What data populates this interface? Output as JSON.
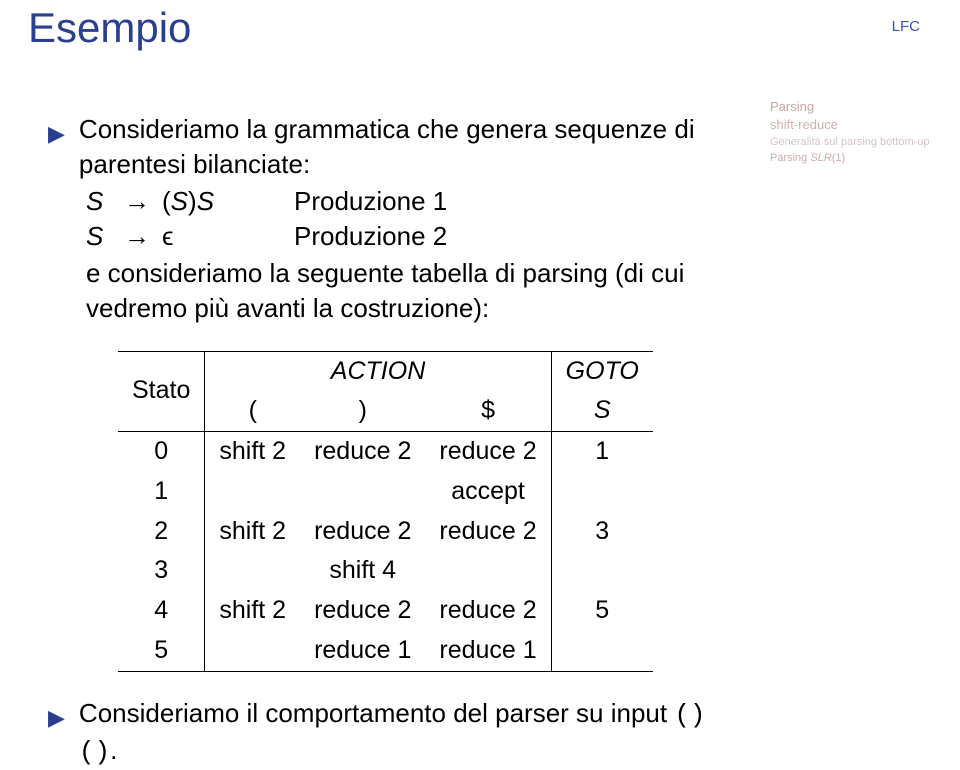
{
  "header": {
    "title": "Esempio",
    "lfc": "LFC"
  },
  "sidebar": {
    "parsing": "Parsing",
    "shiftreduce": "shift-reduce",
    "generalita": "Generalità sul parsing bottom-up",
    "slr1_pre": "Parsing ",
    "slr1_it": "SLR",
    "slr1_suf": "(1)"
  },
  "bullet1": {
    "line1": "Consideriamo la grammatica che genera sequenze di parentesi bilanciate:",
    "prod1": {
      "lhs": "S",
      "arrow": "→",
      "rhs_open": "(",
      "rhs_mid": "S",
      "rhs_close": ")",
      "rhs_tail": "S",
      "label": "Produzione 1"
    },
    "prod2": {
      "lhs": "S",
      "arrow": "→",
      "eps": "ϵ",
      "label": "Produzione 2"
    },
    "line2": "e consideriamo la seguente tabella di parsing (di cui vedremo più avanti la costruzione):"
  },
  "table": {
    "stato": "Stato",
    "action": "ACTION",
    "goto": "GOTO",
    "cols": {
      "c1": "(",
      "c2": ")",
      "c3": "$",
      "c4": "S"
    },
    "rows": [
      {
        "state": "0",
        "a1": "shift 2",
        "a2": "reduce 2",
        "a3": "reduce 2",
        "g": "1"
      },
      {
        "state": "1",
        "a1": "",
        "a2": "",
        "a3": "accept",
        "g": ""
      },
      {
        "state": "2",
        "a1": "shift 2",
        "a2": "reduce 2",
        "a3": "reduce 2",
        "g": "3"
      },
      {
        "state": "3",
        "a1": "",
        "a2": "shift 4",
        "a3": "",
        "g": ""
      },
      {
        "state": "4",
        "a1": "shift 2",
        "a2": "reduce 2",
        "a3": "reduce 2",
        "g": "5"
      },
      {
        "state": "5",
        "a1": "",
        "a2": "reduce 1",
        "a3": "reduce 1",
        "g": ""
      }
    ]
  },
  "bullet2": {
    "text_pre": "Consideriamo il comportamento del parser su input ",
    "input": "()()",
    "dot": "."
  }
}
